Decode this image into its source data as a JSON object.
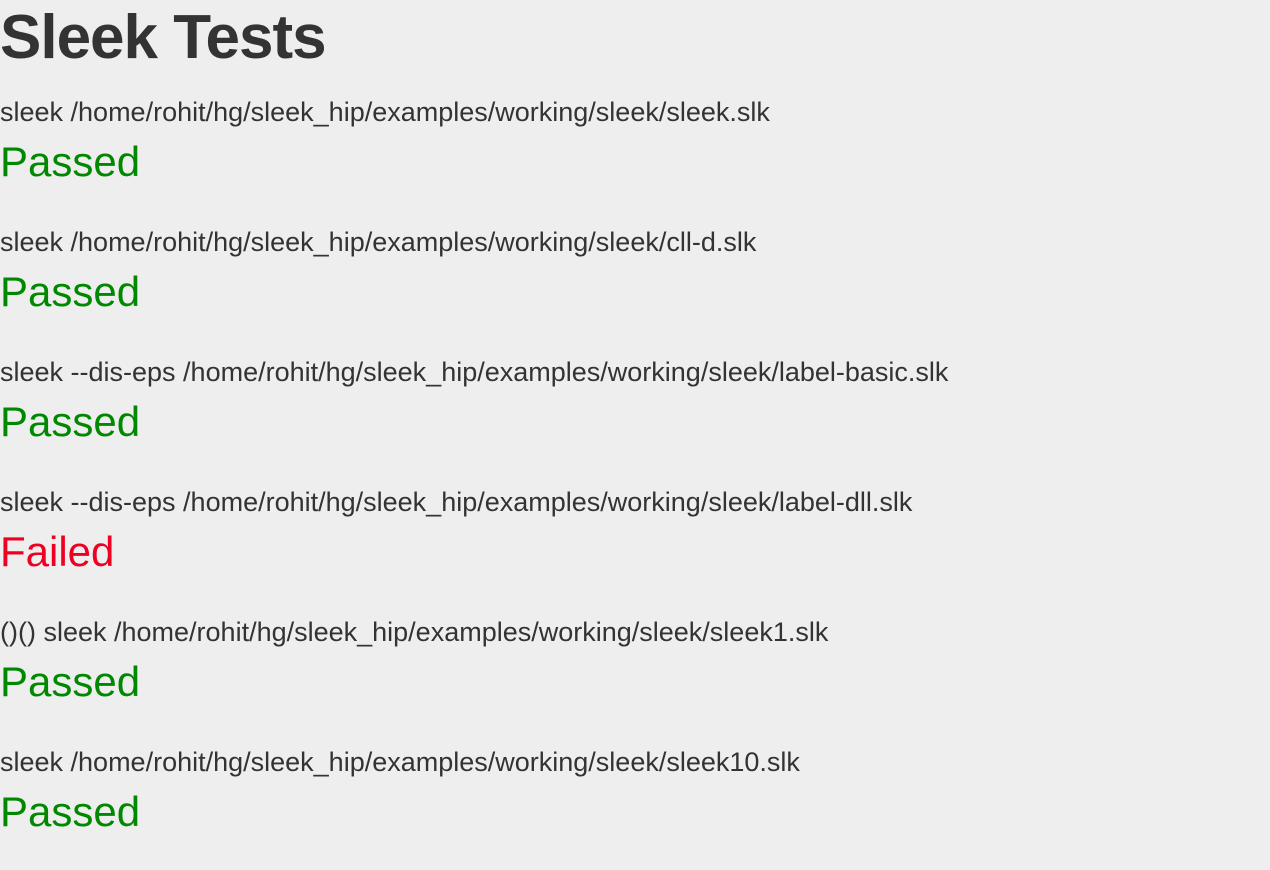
{
  "page": {
    "title": "Sleek Tests"
  },
  "colors": {
    "background": "#eeeeee",
    "text": "#333333",
    "passed": "#008800",
    "failed": "#ee0022"
  },
  "tests": [
    {
      "command": "sleek /home/rohit/hg/sleek_hip/examples/working/sleek/sleek.slk",
      "status": "Passed"
    },
    {
      "command": "sleek /home/rohit/hg/sleek_hip/examples/working/sleek/cll-d.slk",
      "status": "Passed"
    },
    {
      "command": "sleek --dis-eps /home/rohit/hg/sleek_hip/examples/working/sleek/label-basic.slk",
      "status": "Passed"
    },
    {
      "command": "sleek --dis-eps /home/rohit/hg/sleek_hip/examples/working/sleek/label-dll.slk",
      "status": "Failed"
    },
    {
      "command": "()() sleek /home/rohit/hg/sleek_hip/examples/working/sleek/sleek1.slk",
      "status": "Passed"
    },
    {
      "command": "sleek /home/rohit/hg/sleek_hip/examples/working/sleek/sleek10.slk",
      "status": "Passed"
    }
  ]
}
